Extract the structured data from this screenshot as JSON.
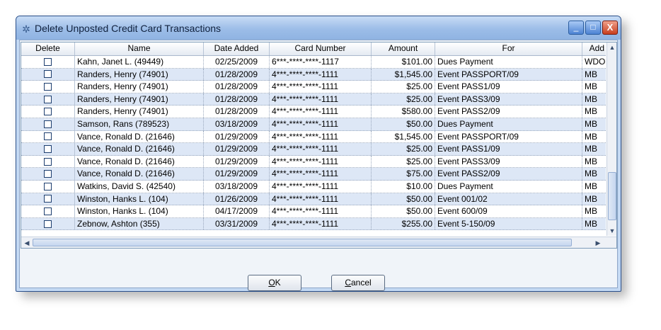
{
  "window": {
    "title": "Delete Unposted Credit Card Transactions",
    "minimize_label": "_",
    "maximize_label": "□",
    "close_label": "X"
  },
  "grid": {
    "columns": [
      "Delete",
      "Name",
      "Date Added",
      "Card Number",
      "Amount",
      "For",
      "Add"
    ],
    "rows": [
      {
        "name": "Kahn, Janet L. (49449)",
        "date": "02/25/2009",
        "card": "6***-****-****-1117",
        "amount": "$101.00",
        "for": "Dues Payment",
        "add": "WDO"
      },
      {
        "name": "Randers, Henry (74901)",
        "date": "01/28/2009",
        "card": "4***-****-****-1111",
        "amount": "$1,545.00",
        "for": "Event PASSPORT/09",
        "add": "MB"
      },
      {
        "name": "Randers, Henry (74901)",
        "date": "01/28/2009",
        "card": "4***-****-****-1111",
        "amount": "$25.00",
        "for": "Event PASS1/09",
        "add": "MB"
      },
      {
        "name": "Randers, Henry (74901)",
        "date": "01/28/2009",
        "card": "4***-****-****-1111",
        "amount": "$25.00",
        "for": "Event PASS3/09",
        "add": "MB"
      },
      {
        "name": "Randers, Henry (74901)",
        "date": "01/28/2009",
        "card": "4***-****-****-1111",
        "amount": "$580.00",
        "for": "Event PASS2/09",
        "add": "MB"
      },
      {
        "name": "Samson, Rans (789523)",
        "date": "03/18/2009",
        "card": "4***-****-****-1111",
        "amount": "$50.00",
        "for": "Dues Payment",
        "add": "MB"
      },
      {
        "name": "Vance, Ronald D. (21646)",
        "date": "01/29/2009",
        "card": "4***-****-****-1111",
        "amount": "$1,545.00",
        "for": "Event PASSPORT/09",
        "add": "MB"
      },
      {
        "name": "Vance, Ronald D. (21646)",
        "date": "01/29/2009",
        "card": "4***-****-****-1111",
        "amount": "$25.00",
        "for": "Event PASS1/09",
        "add": "MB"
      },
      {
        "name": "Vance, Ronald D. (21646)",
        "date": "01/29/2009",
        "card": "4***-****-****-1111",
        "amount": "$25.00",
        "for": "Event PASS3/09",
        "add": "MB"
      },
      {
        "name": "Vance, Ronald D. (21646)",
        "date": "01/29/2009",
        "card": "4***-****-****-1111",
        "amount": "$75.00",
        "for": "Event PASS2/09",
        "add": "MB"
      },
      {
        "name": "Watkins, David S. (42540)",
        "date": "03/18/2009",
        "card": "4***-****-****-1111",
        "amount": "$10.00",
        "for": "Dues Payment",
        "add": "MB"
      },
      {
        "name": "Winston, Hanks L. (104)",
        "date": "01/26/2009",
        "card": "4***-****-****-1111",
        "amount": "$50.00",
        "for": "Event 001/02",
        "add": "MB"
      },
      {
        "name": "Winston, Hanks L. (104)",
        "date": "04/17/2009",
        "card": "4***-****-****-1111",
        "amount": "$50.00",
        "for": "Event 600/09",
        "add": "MB"
      },
      {
        "name": "Zebnow, Ashton (355)",
        "date": "03/31/2009",
        "card": "4***-****-****-1111",
        "amount": "$255.00",
        "for": "Event 5-150/09",
        "add": "MB"
      }
    ]
  },
  "buttons": {
    "ok_underline": "O",
    "ok_rest": "K",
    "cancel_underline": "C",
    "cancel_rest": "ancel"
  },
  "colors": {
    "alt_row": "#dde7f6",
    "title_bar": "#9cbde8",
    "close_button": "#c8401f"
  }
}
